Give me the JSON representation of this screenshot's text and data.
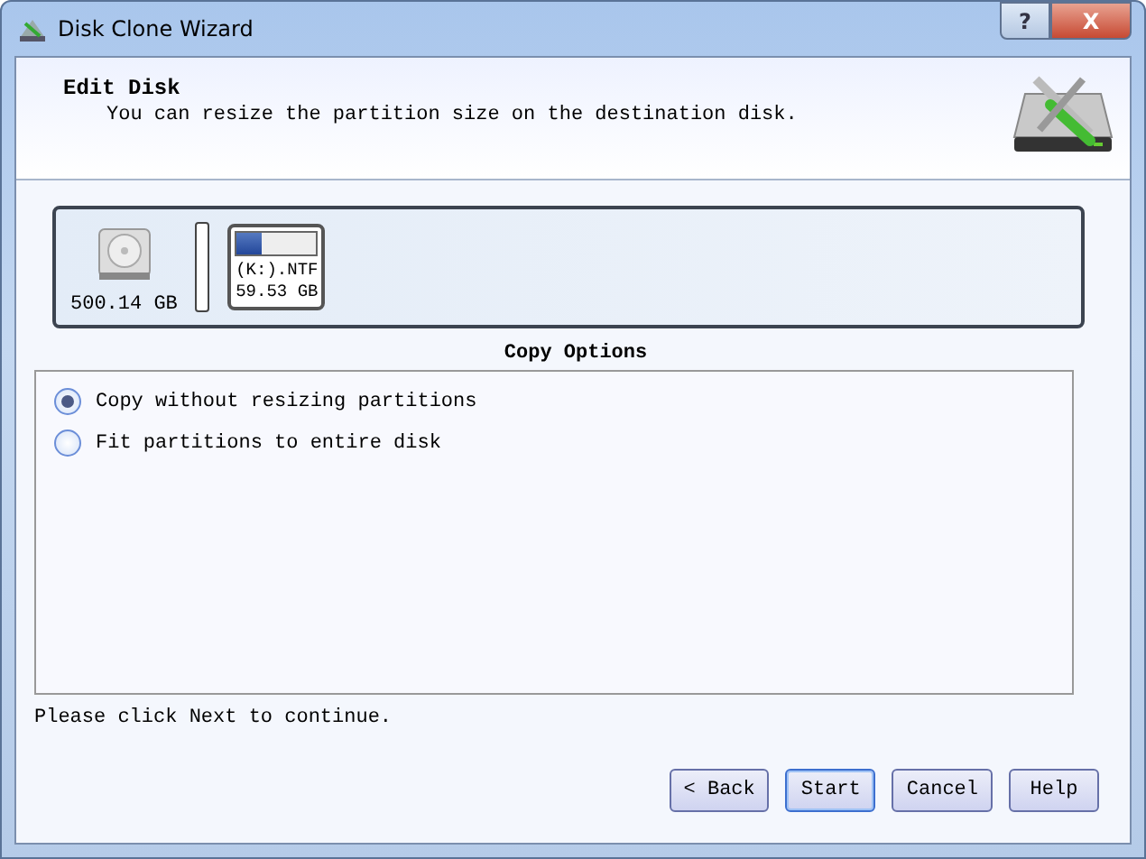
{
  "window": {
    "title": "Disk Clone Wizard",
    "help_button": "?",
    "close_button": "X"
  },
  "header": {
    "title": "Edit Disk",
    "subtitle": "You can resize the partition size on the destination disk."
  },
  "disk": {
    "size": "500.14 GB",
    "partitions": [
      {
        "name": "(K:).NTF",
        "size": "59.53 GB",
        "level": 0.3
      }
    ]
  },
  "copy_options": {
    "title": "Copy Options",
    "options": [
      {
        "label": "Copy without resizing partitions",
        "selected": true
      },
      {
        "label": "Fit partitions to entire disk",
        "selected": false
      }
    ]
  },
  "hint": "Please click Next to continue.",
  "buttons": [
    {
      "label": "< Back",
      "default": false
    },
    {
      "label": "Start",
      "default": true
    },
    {
      "label": "Cancel",
      "default": false
    },
    {
      "label": "Help",
      "default": false
    }
  ]
}
